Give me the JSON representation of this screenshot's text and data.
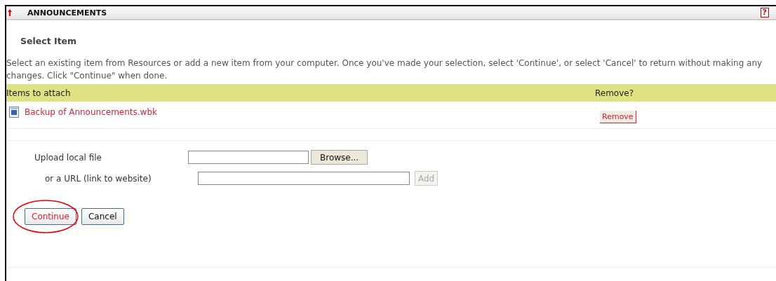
{
  "header": {
    "title": "ANNOUNCEMENTS",
    "help": "?"
  },
  "heading": "Select Item",
  "instructions": "Select an existing item from Resources or add a new item from your computer. Once you've made your selection, select 'Continue', or select 'Cancel' to return without making any changes. Click \"Continue\" when done.",
  "table": {
    "columns": [
      "Items to attach",
      "Remove?"
    ],
    "rows": [
      {
        "name": "Backup of Announcements.wbk",
        "action": "Remove"
      }
    ]
  },
  "upload": {
    "label": "Upload local file",
    "button": "Browse...",
    "disabled": false
  },
  "url": {
    "label": "or a URL (link to website)",
    "button": "Add",
    "disabled": true
  },
  "buttons": [
    {
      "label": "Continue",
      "highlighted": true
    },
    {
      "label": "Cancel",
      "highlighted": false
    }
  ]
}
